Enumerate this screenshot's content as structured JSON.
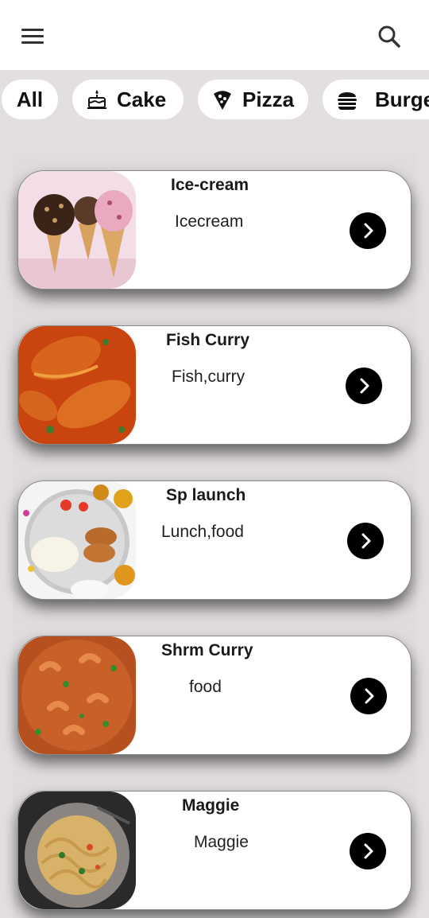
{
  "header": {
    "menu_icon": "hamburger-menu-icon",
    "search_icon": "search-icon"
  },
  "categories": [
    {
      "label": "All",
      "icon": ""
    },
    {
      "label": "Cake",
      "icon": "cake-icon"
    },
    {
      "label": "Pizza",
      "icon": "pizza-slice-icon"
    },
    {
      "label": "Burger",
      "icon": "burger-icon"
    }
  ],
  "items": [
    {
      "title": "Ice-cream",
      "subtitle": "Icecream",
      "image": "ice-cream-cones-photo"
    },
    {
      "title": "Fish Curry",
      "subtitle": "Fish,curry",
      "image": "fish-curry-photo"
    },
    {
      "title": "Sp launch",
      "subtitle": "Lunch,food",
      "image": "thali-lunch-photo"
    },
    {
      "title": "Shrm Curry",
      "subtitle": "food",
      "image": "shrimp-curry-photo"
    },
    {
      "title": "Maggie",
      "subtitle": "Maggie",
      "image": "noodles-photo"
    }
  ]
}
